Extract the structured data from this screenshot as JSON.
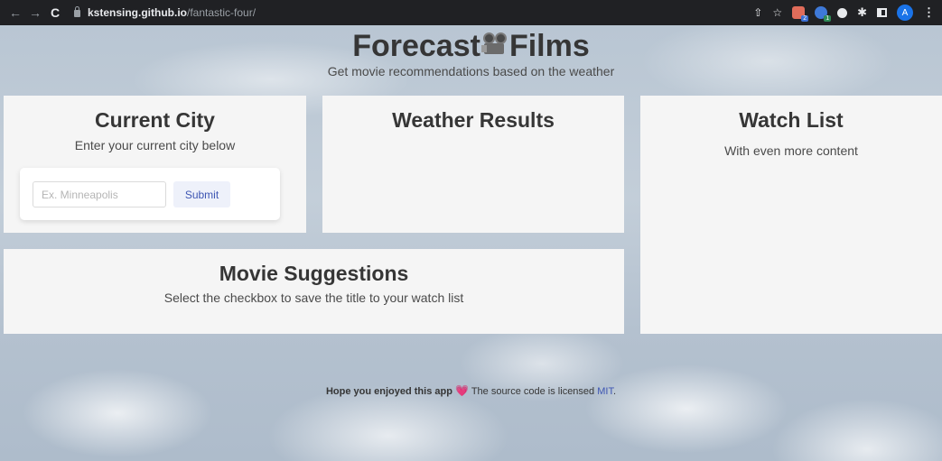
{
  "browser": {
    "url_host": "kstensing.github.io",
    "url_path": "/fantastic-four/",
    "back_icon": "←",
    "forward_icon": "→",
    "reload_icon": "C",
    "profile_initial": "A",
    "ext1_badge": "2",
    "ext2_badge": "1",
    "share_icon": "⇧",
    "bookmark_icon": "☆",
    "puzzle_icon": "✱",
    "menu_icon": "⋮"
  },
  "header": {
    "title_part1": "Forecast",
    "title_part2": "Films",
    "subtitle": "Get movie recommendations based on the weather"
  },
  "city_card": {
    "title": "Current City",
    "subtitle": "Enter your current city below",
    "input_placeholder": "Ex. Minneapolis",
    "input_value": "",
    "submit_label": "Submit"
  },
  "weather_card": {
    "title": "Weather Results"
  },
  "watch_card": {
    "title": "Watch List",
    "subtitle": "With even more content"
  },
  "movie_card": {
    "title": "Movie Suggestions",
    "subtitle": "Select the checkbox to save the title to your watch list"
  },
  "footer": {
    "bold_text": "Hope you enjoyed this app",
    "heart": "💗",
    "text": "The source code is licensed",
    "link": "MIT",
    "period": "."
  },
  "colors": {
    "link": "#3e56b3",
    "card_bg": "#f5f5f5",
    "chrome_bg": "#202124"
  }
}
